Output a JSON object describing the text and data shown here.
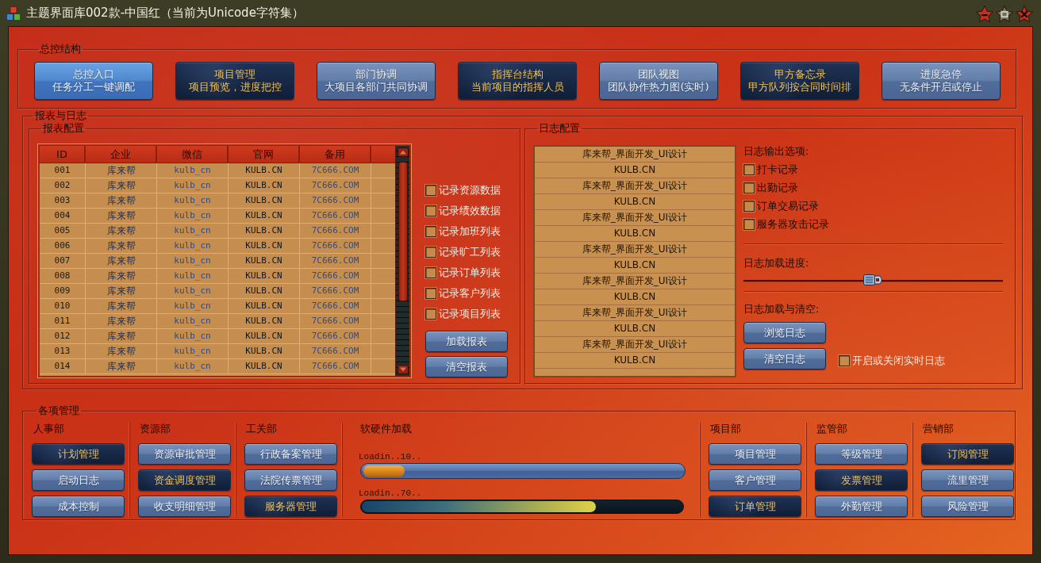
{
  "window": {
    "title": "主题界面库002款-中国红（当前为Unicode字符集）",
    "controls": [
      {
        "kind": "minimize",
        "disabled": false
      },
      {
        "kind": "maximize",
        "disabled": true
      },
      {
        "kind": "close",
        "disabled": false
      }
    ]
  },
  "master": {
    "title": "总控结构",
    "buttons": [
      {
        "title": "总控入口",
        "subtitle": "任务分工一键调配",
        "kind": "focus"
      },
      {
        "title": "项目管理",
        "subtitle": "项目预览，进度把控",
        "kind": "dark"
      },
      {
        "title": "部门协调",
        "subtitle": "大项目各部门共同协调",
        "kind": "plain"
      },
      {
        "title": "指挥台结构",
        "subtitle": "当前项目的指挥人员",
        "kind": "dark"
      },
      {
        "title": "团队视图",
        "subtitle": "团队协作热力图(实时)",
        "kind": "plain"
      },
      {
        "title": "甲方备忘录",
        "subtitle": "甲方队列按合同时间排",
        "kind": "dark"
      },
      {
        "title": "进度急停",
        "subtitle": "无条件开启或停止",
        "kind": "plain"
      }
    ]
  },
  "reports": {
    "title": "报表与日志",
    "report_config": {
      "title": "报表配置",
      "table": {
        "columns": [
          "ID",
          "企业",
          "微信",
          "官网",
          "备用"
        ],
        "rows": [
          [
            "001",
            "库来帮",
            "kulb_cn",
            "KULB.CN",
            "7C666.COM"
          ],
          [
            "002",
            "库来帮",
            "kulb_cn",
            "KULB.CN",
            "7C666.COM"
          ],
          [
            "003",
            "库来帮",
            "kulb_cn",
            "KULB.CN",
            "7C666.COM"
          ],
          [
            "004",
            "库来帮",
            "kulb_cn",
            "KULB.CN",
            "7C666.COM"
          ],
          [
            "005",
            "库来帮",
            "kulb_cn",
            "KULB.CN",
            "7C666.COM"
          ],
          [
            "006",
            "库来帮",
            "kulb_cn",
            "KULB.CN",
            "7C666.COM"
          ],
          [
            "007",
            "库来帮",
            "kulb_cn",
            "KULB.CN",
            "7C666.COM"
          ],
          [
            "008",
            "库来帮",
            "kulb_cn",
            "KULB.CN",
            "7C666.COM"
          ],
          [
            "009",
            "库来帮",
            "kulb_cn",
            "KULB.CN",
            "7C666.COM"
          ],
          [
            "010",
            "库来帮",
            "kulb_cn",
            "KULB.CN",
            "7C666.COM"
          ],
          [
            "011",
            "库来帮",
            "kulb_cn",
            "KULB.CN",
            "7C666.COM"
          ],
          [
            "012",
            "库来帮",
            "kulb_cn",
            "KULB.CN",
            "7C666.COM"
          ],
          [
            "013",
            "库来帮",
            "kulb_cn",
            "KULB.CN",
            "7C666.COM"
          ],
          [
            "014",
            "库来帮",
            "kulb_cn",
            "KULB.CN",
            "7C666.COM"
          ]
        ]
      },
      "options": [
        {
          "label": "记录资源数据",
          "checked": false
        },
        {
          "label": "记录绩效数据",
          "checked": false
        },
        {
          "label": "记录加班列表",
          "checked": false
        },
        {
          "label": "记录旷工列表",
          "checked": false
        },
        {
          "label": "记录订单列表",
          "checked": false
        },
        {
          "label": "记录客户列表",
          "checked": false
        },
        {
          "label": "记录项目列表",
          "checked": false
        }
      ],
      "buttons": [
        "加载报表",
        "清空报表"
      ]
    },
    "log_config": {
      "title": "日志配置",
      "entries": [
        "库来帮_界面开发_UI设计",
        "KULB.CN",
        "库来帮_界面开发_UI设计",
        "KULB.CN",
        "库来帮_界面开发_UI设计",
        "KULB.CN",
        "库来帮_界面开发_UI设计",
        "KULB.CN",
        "库来帮_界面开发_UI设计",
        "KULB.CN",
        "库来帮_界面开发_UI设计",
        "KULB.CN",
        "库来帮_界面开发_UI设计",
        "KULB.CN"
      ],
      "output_title": "日志输出选项:",
      "output_options": [
        {
          "label": "打卡记录",
          "checked": false
        },
        {
          "label": "出勤记录",
          "checked": false
        },
        {
          "label": "订单交易记录",
          "checked": false
        },
        {
          "label": "服务器攻击记录",
          "checked": false
        }
      ],
      "progress": {
        "label": "日志加载进度:",
        "level": 0.5
      },
      "actions_title": "日志加载与清空:",
      "buttons": [
        "浏览日志",
        "清空日志"
      ],
      "realtime": {
        "label": "开启或关闭实时日志",
        "checked": false
      }
    }
  },
  "management": {
    "title": "各项管理",
    "groups": [
      {
        "kind": "buttons",
        "title": "人事部",
        "buttons": [
          {
            "label": "计划管理",
            "kind": "dark"
          },
          {
            "label": "启动日志",
            "kind": "plain"
          },
          {
            "label": "成本控制",
            "kind": "plain"
          }
        ]
      },
      {
        "kind": "buttons",
        "title": "资源部",
        "buttons": [
          {
            "label": "资源审批管理",
            "kind": "plain"
          },
          {
            "label": "资金调度管理",
            "kind": "dark"
          },
          {
            "label": "收支明细管理",
            "kind": "plain"
          }
        ]
      },
      {
        "kind": "buttons",
        "title": "工关部",
        "buttons": [
          {
            "label": "行政备案管理",
            "kind": "plain"
          },
          {
            "label": "法院传票管理",
            "kind": "plain"
          },
          {
            "label": "服务器管理",
            "kind": "dark"
          }
        ]
      },
      {
        "kind": "loading",
        "title": "软硬件加载",
        "bars": [
          {
            "label": "Loadin..10..",
            "level": 0.13,
            "kind": "light"
          },
          {
            "label": "Loadin..70..",
            "level": 0.73,
            "kind": "dark"
          }
        ]
      },
      {
        "kind": "buttons",
        "title": "项目部",
        "buttons": [
          {
            "label": "项目管理",
            "kind": "plain"
          },
          {
            "label": "客户管理",
            "kind": "plain"
          },
          {
            "label": "订单管理",
            "kind": "dark"
          }
        ]
      },
      {
        "kind": "buttons",
        "title": "监管部",
        "buttons": [
          {
            "label": "等级管理",
            "kind": "plain"
          },
          {
            "label": "发票管理",
            "kind": "dark"
          },
          {
            "label": "外勤管理",
            "kind": "plain"
          }
        ]
      },
      {
        "kind": "buttons",
        "title": "营销部",
        "buttons": [
          {
            "label": "订阅管理",
            "kind": "dark"
          },
          {
            "label": "流里管理",
            "kind": "plain"
          },
          {
            "label": "风险管理",
            "kind": "plain"
          }
        ]
      }
    ]
  }
}
